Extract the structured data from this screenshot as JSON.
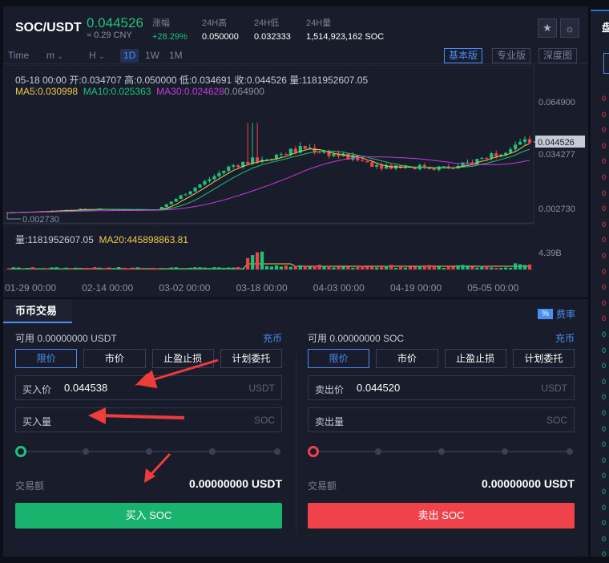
{
  "header": {
    "pair": "SOC/USDT",
    "last_price": "0.044526",
    "cny": "≈ 0.29 CNY",
    "stats": [
      {
        "label": "涨幅",
        "value": "+28.29%",
        "up": true
      },
      {
        "label": "24H高",
        "value": "0.050000",
        "up": false
      },
      {
        "label": "24H低",
        "value": "0.032333",
        "up": false
      },
      {
        "label": "24H量",
        "value": "1,514,923,162 SOC",
        "up": false
      }
    ]
  },
  "toolbar": {
    "time_label": "Time",
    "m_label": "m",
    "h_label": "H",
    "periods": [
      "1D",
      "1W",
      "1M"
    ],
    "selected_period": "1D",
    "views": [
      "基本版",
      "专业版",
      "深度图"
    ],
    "selected_view": "基本版"
  },
  "chart_info": {
    "ohlc": "05-18 00:00   开:0.034707  高:0.050000  低:0.034691  收:0.044526  量:1181952607.05",
    "ma5": "MA5:0.030998",
    "ma10": "MA10:0.025363",
    "ma30": "MA30:0.024628",
    "ma30_extra": "0.064900",
    "vol": "量:1181952607.05",
    "ma20": "MA20:445898863.81",
    "price_axis": [
      "0.064900",
      "0.034277",
      "0.002730"
    ],
    "current_price_tag": "0.044526",
    "min_label": "0.002730",
    "vol_axis": "4.39B",
    "dates": [
      "01-29 00:00",
      "02-14 00:00",
      "03-02 00:00",
      "03-18 00:00",
      "04-03 00:00",
      "04-19 00:00",
      "05-05 00:00"
    ]
  },
  "chart_data": {
    "type": "candlestick",
    "x": [
      "01-29",
      "02-14",
      "03-02",
      "03-18",
      "04-03",
      "04-19",
      "05-05",
      "05-18"
    ],
    "close": [
      0.0035,
      0.0055,
      0.0052,
      0.03,
      0.04,
      0.03,
      0.0285,
      0.044526
    ],
    "high": 0.05,
    "low": 0.00273,
    "ylim": [
      0.00273,
      0.0649
    ],
    "colors": {
      "up": "#1ec37a",
      "down": "#f0424b",
      "ma5": "#f2c94c",
      "ma10": "#1ec37a",
      "ma30": "#c53cd8"
    }
  },
  "trade": {
    "tab": "币币交易",
    "fee_pct": "%",
    "fee_label": "费率",
    "order_types": [
      "限价",
      "市价",
      "止盈止损",
      "计划委托"
    ],
    "buy": {
      "avail": "可用  0.00000000 USDT",
      "charge": "充币",
      "price_label": "买入价",
      "price_value": "0.044538",
      "price_unit": "USDT",
      "qty_label": "买入量",
      "qty_unit": "SOC",
      "amount_label": "交易额",
      "amount_value": "0.00000000 USDT",
      "button": "买入 SOC"
    },
    "sell": {
      "avail": "可用  0.00000000 SOC",
      "charge": "充币",
      "price_label": "卖出价",
      "price_value": "0.044520",
      "price_unit": "USDT",
      "qty_label": "卖出量",
      "qty_unit": "SOC",
      "amount_label": "交易额",
      "amount_value": "0.00000000 USDT",
      "button": "卖出 SOC"
    }
  },
  "icons": [
    "star-icon",
    "sun-icon"
  ],
  "sidepanel_glyph": "盘"
}
